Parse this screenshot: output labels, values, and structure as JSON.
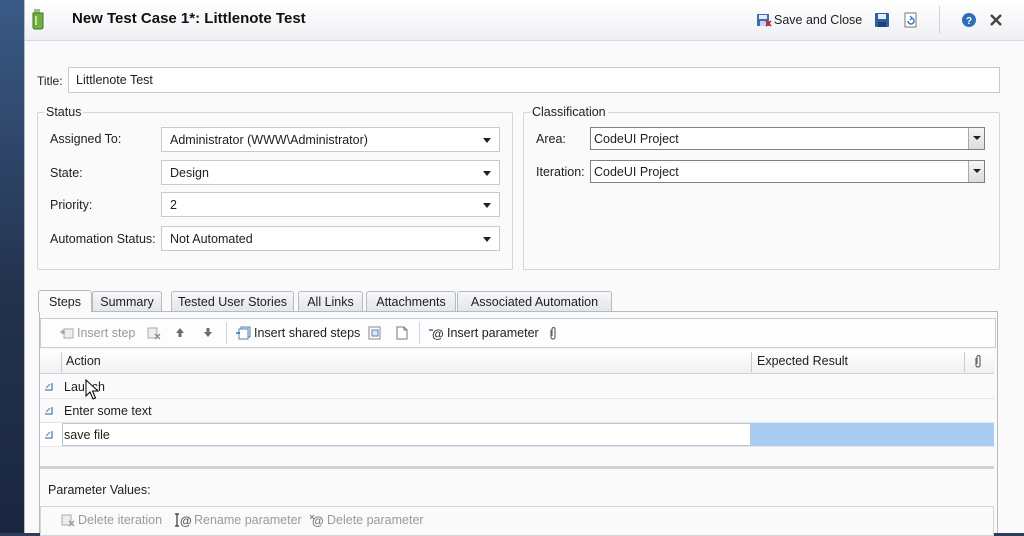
{
  "window": {
    "title": "New Test Case 1*: Littlenote Test",
    "save_close_label": "Save and Close"
  },
  "title_field": {
    "label": "Title:",
    "value": "Littlenote Test"
  },
  "status": {
    "group_label": "Status",
    "fields": [
      {
        "label": "Assigned To:",
        "value": "Administrator (WWW\\Administrator)"
      },
      {
        "label": "State:",
        "value": "Design"
      },
      {
        "label": "Priority:",
        "value": "2"
      },
      {
        "label": "Automation Status:",
        "value": "Not Automated"
      }
    ]
  },
  "classification": {
    "group_label": "Classification",
    "fields": [
      {
        "label": "Area:",
        "value": "CodeUI Project"
      },
      {
        "label": "Iteration:",
        "value": "CodeUI Project"
      }
    ]
  },
  "tabs": [
    {
      "label": "Steps",
      "active": true
    },
    {
      "label": "Summary"
    },
    {
      "label": "Tested User Stories"
    },
    {
      "label": "All Links"
    },
    {
      "label": "Attachments"
    },
    {
      "label": "Associated Automation"
    }
  ],
  "steps_toolbar": {
    "insert_step": "Insert step",
    "insert_shared_steps": "Insert shared steps",
    "insert_parameter": "Insert parameter"
  },
  "steps_grid": {
    "columns": {
      "action": "Action",
      "expected": "Expected Result"
    },
    "rows": [
      {
        "action": "Launch",
        "expected": ""
      },
      {
        "action": "Enter some text",
        "expected": ""
      },
      {
        "action": "save file",
        "expected": ""
      }
    ]
  },
  "parameters": {
    "label": "Parameter Values:",
    "delete_iteration": "Delete iteration",
    "rename_parameter": "Rename parameter",
    "delete_parameter": "Delete parameter"
  },
  "colors": {
    "selection": "#a9ccf2",
    "accent_blue": "#2f6fb5"
  }
}
